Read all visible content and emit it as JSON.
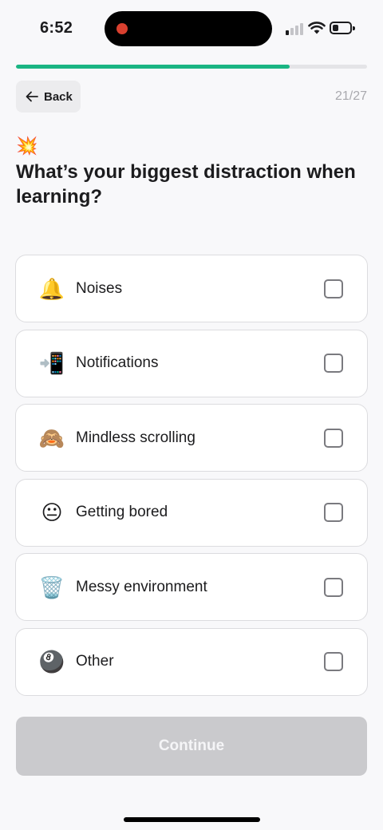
{
  "status_bar": {
    "time": "6:52",
    "recording_indicator_color": "#d9402f",
    "signal_icon": "cellular-signal-icon",
    "wifi_icon": "wifi-icon",
    "battery_icon": "battery-icon",
    "battery_level": 0.35
  },
  "progress": {
    "fraction": 0.779,
    "color": "#1ab583"
  },
  "header": {
    "back_label": "Back",
    "back_icon": "arrow-left-icon",
    "step_counter": "21/27"
  },
  "question": {
    "emoji": "💥",
    "title": "What’s your biggest distraction when learning?"
  },
  "options": [
    {
      "emoji": "🔔",
      "label": "Noises",
      "checked": false
    },
    {
      "emoji": "📲",
      "label": "Notifications",
      "checked": false
    },
    {
      "emoji": "🙈",
      "label": "Mindless scrolling",
      "checked": false
    },
    {
      "emoji": "😐",
      "label": "Getting bored",
      "checked": false
    },
    {
      "emoji": "🗑️",
      "label": "Messy environment",
      "checked": false
    },
    {
      "emoji": "🎱",
      "label": "Other",
      "checked": false
    }
  ],
  "footer": {
    "continue_label": "Continue",
    "continue_enabled": false
  }
}
